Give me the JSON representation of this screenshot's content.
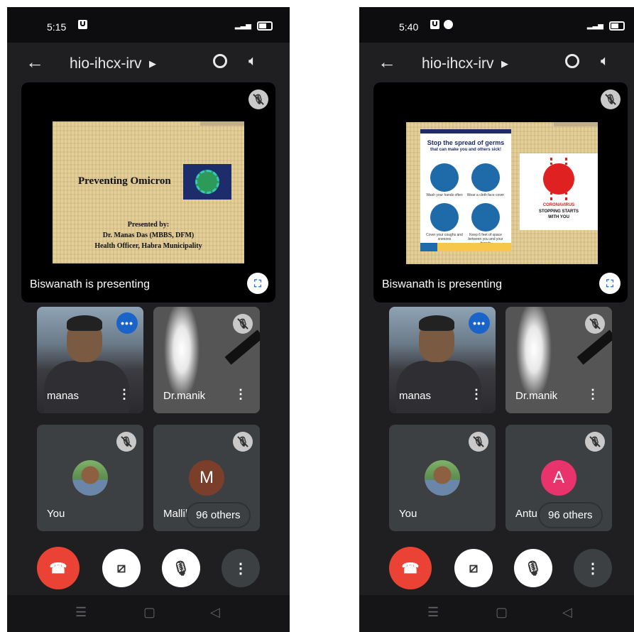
{
  "phones": [
    {
      "status_time": "5:15",
      "meeting_code": "hio-ihcx-irv",
      "presenting_label": "Biswanath is presenting",
      "slide": {
        "title": "Preventing Omicron",
        "line1": "Presented by:",
        "line2": "Dr. Manas Das (MBBS, DFM)",
        "line3": "Health Officer, Habra Municipality"
      },
      "tiles": {
        "t1_name": "manas",
        "t2_name": "Dr.manik",
        "t3_name": "You",
        "t4_name": "Mallik",
        "t4_initial": "M",
        "t4_color": "#7a3e2a"
      },
      "others_label": "96 others"
    },
    {
      "status_time": "5:40",
      "meeting_code": "hio-ihcx-irv",
      "presenting_label": "Biswanath is presenting",
      "slide": {
        "poster_title": "Stop the spread of germs",
        "poster_subtitle": "that can make you and others sick!",
        "cap1": "Wash your hands often",
        "cap2": "Wear a cloth face cover",
        "cap3": "Cover your coughs and sneezes",
        "cap4": "Keep 6 feet of space between you and your friends",
        "panel_line1": "CORONAVIRUS",
        "panel_line2": "STOPPING STARTS",
        "panel_line3": "WITH YOU"
      },
      "tiles": {
        "t1_name": "manas",
        "t2_name": "Dr.manik",
        "t3_name": "You",
        "t4_name": "Antu",
        "t4_initial": "A",
        "t4_color": "#e8336d"
      },
      "others_label": "96 others"
    }
  ],
  "icons": {
    "back": "arrow-left-icon",
    "camera_flip": "camera-flip-icon",
    "speaker": "speaker-icon",
    "mic_off": "mic-off-icon",
    "fullscreen": "fullscreen-icon",
    "end_call": "phone-hangup-icon",
    "camera_off": "camera-off-icon",
    "more": "more-vert-icon"
  }
}
